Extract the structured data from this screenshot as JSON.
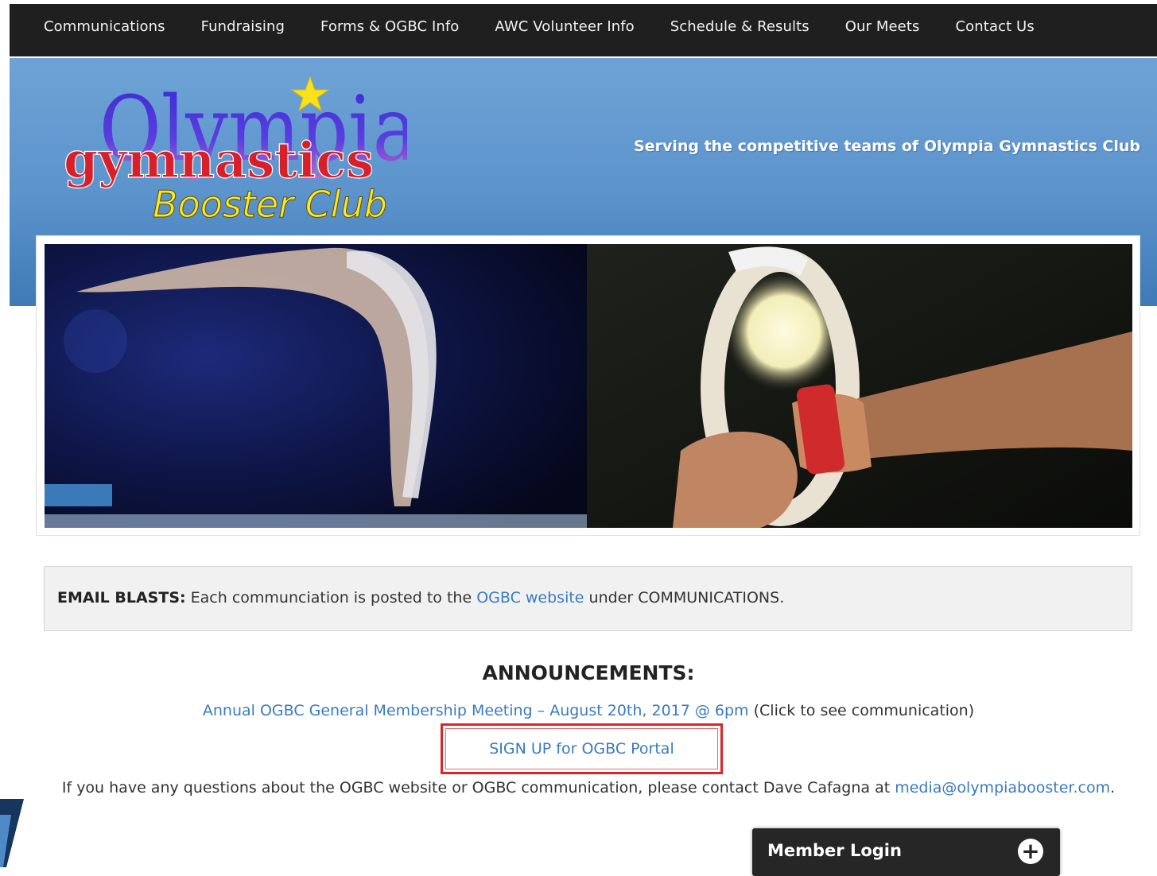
{
  "nav": {
    "items": [
      {
        "label": "Communications"
      },
      {
        "label": "Fundraising"
      },
      {
        "label": "Forms & OGBC Info"
      },
      {
        "label": "AWC Volunteer Info"
      },
      {
        "label": "Schedule & Results"
      },
      {
        "label": "Our Meets"
      },
      {
        "label": "Contact Us"
      }
    ]
  },
  "header": {
    "logo": {
      "line1": "Olympia",
      "line2": "gymnastics",
      "line3": "Booster Club"
    },
    "tagline": "Serving the competitive teams of Olympia Gymnastics Club"
  },
  "notice": {
    "label": "EMAIL BLASTS:",
    "text_before": "Each communciation is posted to the",
    "link": "OGBC website",
    "text_after": "under COMMUNICATIONS."
  },
  "announcements": {
    "title": "ANNOUNCEMENTS:",
    "meeting_link": "Annual OGBC General Membership Meeting – August 20th, 2017 @ 6pm",
    "meeting_note": "(Click to see communication)",
    "signup_link": "SIGN UP for OGBC Portal",
    "contact_text": "If you have any questions about the OGBC website or OGBC communication, please contact Dave Cafagna at",
    "contact_email": "media@olympiabooster.com",
    "contact_end": "."
  },
  "login": {
    "label": "Member Login",
    "expand_icon": "plus-circle-icon"
  },
  "colors": {
    "nav_bg": "#1f1f1f",
    "header_blue": "#5b93cc",
    "link": "#3a7bbf",
    "highlight_box": "#d9262b"
  }
}
